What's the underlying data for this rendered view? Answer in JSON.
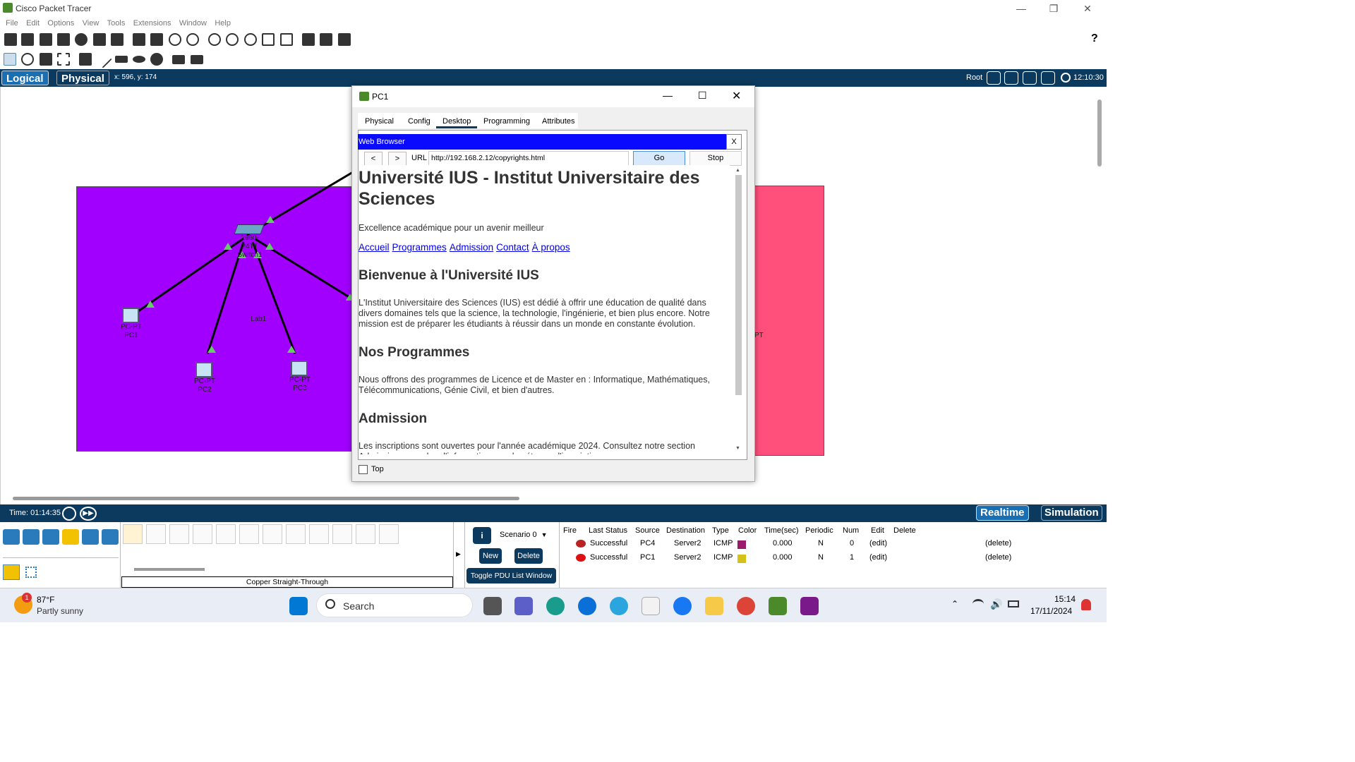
{
  "window": {
    "title": "Cisco Packet Tracer"
  },
  "menu": [
    "File",
    "Edit",
    "Options",
    "View",
    "Tools",
    "Extensions",
    "Window",
    "Help"
  ],
  "modebar": {
    "logical": "Logical",
    "physical": "Physical",
    "coords": "x: 596, y: 174",
    "root": "Root",
    "time": "12:10:30"
  },
  "workspace": {
    "devices": [
      {
        "type": "PC-PT",
        "name": "PC1"
      },
      {
        "type": "PC-PT",
        "name": "PC2"
      },
      {
        "type": "PC-PT",
        "name": "PC3"
      },
      {
        "type": "2960-24TT",
        "name": "Switch1"
      }
    ],
    "cluster_label": "Lab1",
    "right_partial": "PT"
  },
  "dialog": {
    "title": "PC1",
    "tabs": [
      "Physical",
      "Config",
      "Desktop",
      "Programming",
      "Attributes"
    ],
    "active_tab": "Desktop",
    "browser": {
      "title": "Web Browser",
      "close": "X",
      "back": "<",
      "forward": ">",
      "url_label": "URL",
      "url": "http://192.168.2.12/copyrights.html",
      "go": "Go",
      "stop": "Stop"
    },
    "top_checkbox": "Top",
    "page": {
      "h1": "Université IUS - Institut Universitaire des Sciences",
      "tagline": "Excellence académique pour un avenir meilleur",
      "nav": [
        "Accueil",
        "Programmes",
        "Admission",
        "Contact",
        "À propos"
      ],
      "h2_welcome": "Bienvenue à l'Université IUS",
      "p_welcome": "L'Institut Universitaire des Sciences (IUS) est dédié à offrir une éducation de qualité dans divers domaines tels que la science, la technologie, l'ingénierie, et bien plus encore. Notre mission est de préparer les étudiants à réussir dans un monde en constante évolution.",
      "h2_programs": "Nos Programmes",
      "p_programs": "Nous offrons des programmes de Licence et de Master en : Informatique, Mathématiques, Télécommunications, Génie Civil, et bien d'autres.",
      "h2_admission": "Admission",
      "p_admission": "Les inscriptions sont ouvertes pour l'année académique 2024. Consultez notre section Admission pour plus d'informations sur les étapes d'inscription."
    }
  },
  "statusbar": {
    "time": "Time: 01:14:35",
    "realtime": "Realtime",
    "simulation": "Simulation"
  },
  "bottom": {
    "connection_label": "Copper Straight-Through",
    "scenario": "Scenario 0",
    "new": "New",
    "delete": "Delete",
    "toggle": "Toggle PDU List Window",
    "headers": [
      "Fire",
      "Last Status",
      "Source",
      "Destination",
      "Type",
      "Color",
      "Time(sec)",
      "Periodic",
      "Num",
      "Edit",
      "Delete"
    ],
    "rows": [
      {
        "status": "Successful",
        "source": "PC4",
        "dest": "Server2",
        "type": "ICMP",
        "color": "#9b1a6e",
        "time": "0.000",
        "periodic": "N",
        "num": "0",
        "edit": "(edit)",
        "delete": "(delete)"
      },
      {
        "status": "Successful",
        "source": "PC1",
        "dest": "Server2",
        "type": "ICMP",
        "color": "#d4c21a",
        "time": "0.000",
        "periodic": "N",
        "num": "1",
        "edit": "(edit)",
        "delete": "(delete)"
      }
    ]
  },
  "taskbar": {
    "temp": "87°F",
    "weather": "Partly sunny",
    "badge": "1",
    "search": "Search",
    "clock": "15:14",
    "date": "17/11/2024"
  }
}
